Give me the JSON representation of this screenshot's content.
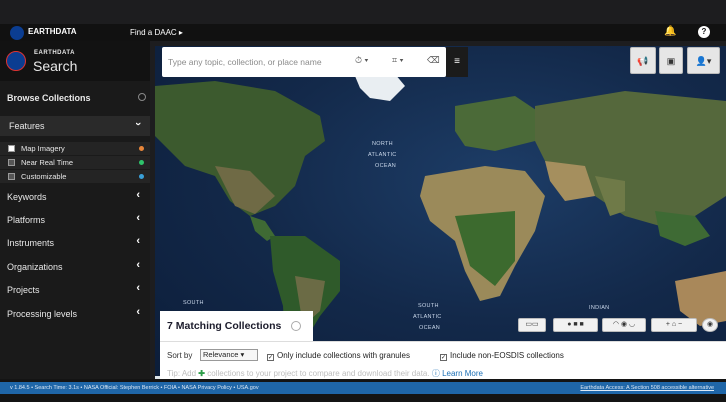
{
  "topbar": {
    "brand": "EARTHDATA",
    "find_daac": "Find a DAAC ▸"
  },
  "sidebar": {
    "logo_small": "EARTHDATA",
    "logo_large": "Search",
    "browse_title": "Browse Collections",
    "features_label": "Features",
    "features_items": [
      {
        "label": "Map Imagery",
        "checked": true,
        "color": "#e8863a"
      },
      {
        "label": "Near Real Time",
        "checked": false,
        "color": "#2ec46b"
      },
      {
        "label": "Customizable",
        "checked": false,
        "color": "#3aa0d8"
      }
    ],
    "sections": [
      "Keywords",
      "Platforms",
      "Instruments",
      "Organizations",
      "Projects",
      "Processing levels"
    ]
  },
  "search": {
    "placeholder": "Type any topic, collection, or place name"
  },
  "map": {
    "labels": [
      "NORTH",
      "ATLANTIC",
      "OCEAN",
      "SOUTH",
      "SOUTH",
      "ATLANTIC",
      "OCEAN",
      "INDIAN"
    ]
  },
  "results": {
    "title": "7 Matching Collections",
    "sort_label": "Sort by",
    "sort_value": "Relevance",
    "only_granules": "Only include collections with granules",
    "non_eosdis": "Include non-EOSDIS collections",
    "tip_prefix": "Tip: Add",
    "tip_text": "collections to your project to compare and download their data.",
    "learn_more": "Learn More"
  },
  "footer": {
    "left": "v 1.84.5 • Search Time: 3.1s • NASA Official: Stephen Berrick • FOIA • NASA Privacy Policy • USA.gov",
    "right": "Earthdata Access: A Section 508 accessible alternative"
  },
  "colors": {
    "sidebar_bg": "#1a1a1a",
    "footer_bar": "#1f66a8",
    "link": "#1b6fb5"
  }
}
